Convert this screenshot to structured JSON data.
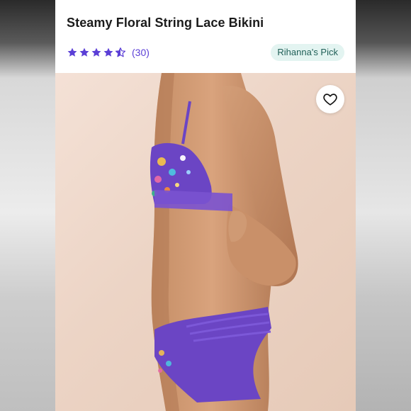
{
  "product": {
    "title": "Steamy Floral String Lace Bikini",
    "rating": 4.5,
    "review_count": "(30)",
    "badge": "Rihanna's Pick"
  },
  "icons": {
    "star": "star-icon",
    "half_star": "star-half-icon",
    "favorite": "heart-icon"
  },
  "colors": {
    "star": "#5b3fd6",
    "badge_bg": "#e3f4f1",
    "badge_text": "#1f5f57",
    "lingerie": "#6b45c4"
  }
}
